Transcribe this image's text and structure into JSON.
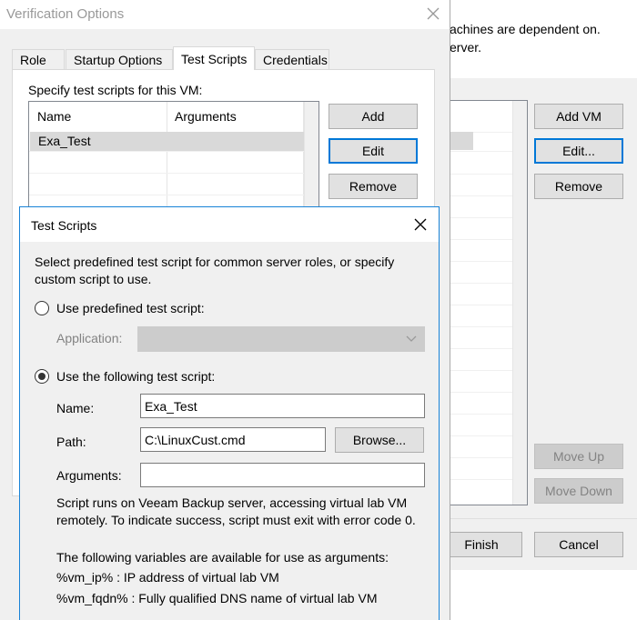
{
  "background_wizard": {
    "line1": "achines are dependent on.",
    "line2": "erver.",
    "buttons": {
      "add_vm": "Add VM",
      "edit": "Edit...",
      "remove": "Remove",
      "move_up": "Move Up",
      "move_down": "Move Down",
      "finish": "Finish",
      "cancel": "Cancel"
    }
  },
  "verification_options": {
    "title": "Verification Options",
    "tabs": [
      {
        "label": "Role"
      },
      {
        "label": "Startup Options"
      },
      {
        "label": "Test Scripts"
      },
      {
        "label": "Credentials"
      }
    ],
    "test_scripts_label": "Specify test scripts for this VM:",
    "table": {
      "columns": [
        "Name",
        "Arguments"
      ],
      "rows": [
        {
          "name": "Exa_Test",
          "arguments": ""
        }
      ]
    },
    "buttons": {
      "add": "Add",
      "edit": "Edit",
      "remove": "Remove"
    }
  },
  "test_scripts_dialog": {
    "title": "Test Scripts",
    "description": "Select predefined test script for common server roles, or specify custom script to use.",
    "option_predefined": "Use predefined test script:",
    "application_label": "Application:",
    "application_value": "",
    "option_custom": "Use the following test script:",
    "name_label": "Name:",
    "name_value": "Exa_Test",
    "path_label": "Path:",
    "path_value": "C:\\LinuxCust.cmd",
    "browse_label": "Browse...",
    "arguments_label": "Arguments:",
    "arguments_value": "",
    "info_text": "Script runs on Veeam Backup server, accessing virtual lab VM remotely. To indicate success, script must exit with error code 0.",
    "variables_heading": "The following variables are available for use as arguments:",
    "variable_ip": "%vm_ip% : IP address of virtual lab VM",
    "variable_fqdn": "%vm_fqdn% : Fully qualified DNS name of virtual lab VM"
  }
}
